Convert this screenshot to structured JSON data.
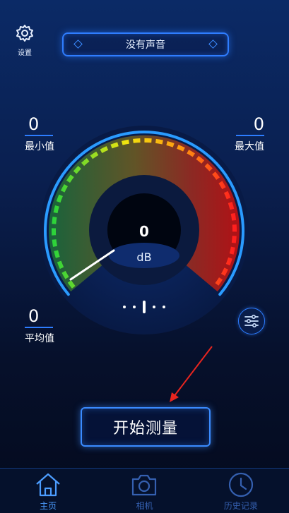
{
  "header": {
    "settings_label": "设置",
    "status_text": "没有声音"
  },
  "stats": {
    "min_value": "0",
    "min_label": "最小值",
    "max_value": "0",
    "max_label": "最大值",
    "avg_value": "0",
    "avg_label": "平均值"
  },
  "gauge": {
    "value": "0",
    "unit": "dB",
    "level": 0
  },
  "actions": {
    "start_label": "开始测量"
  },
  "tabs": [
    {
      "label": "主页",
      "icon": "home-icon",
      "active": true
    },
    {
      "label": "相机",
      "icon": "camera-icon",
      "active": false
    },
    {
      "label": "历史记录",
      "icon": "clock-icon",
      "active": false
    }
  ],
  "colors": {
    "accent": "#2d7dff",
    "background": "#0a1f4f",
    "active_tab": "#4c9dff"
  }
}
